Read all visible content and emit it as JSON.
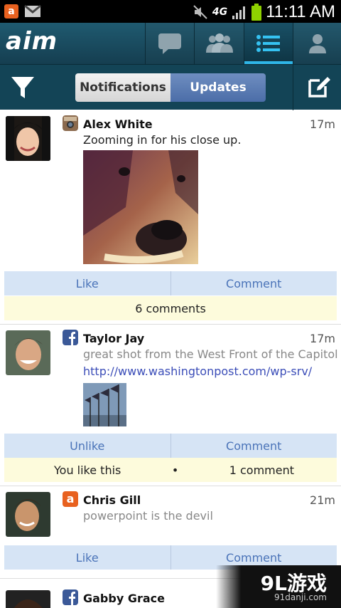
{
  "status_bar": {
    "time": "11:11 AM",
    "network": "4G",
    "icons": [
      "app-notification-icon",
      "gmail-icon",
      "mute-icon",
      "signal-icon",
      "battery-icon"
    ]
  },
  "app": {
    "logo": "aim",
    "tabs": [
      "chat-icon",
      "buddies-icon",
      "list-icon",
      "profile-icon"
    ],
    "active_tab": "list-icon",
    "accent": "#2fb6e8"
  },
  "toolbar": {
    "notifications_label": "Notifications",
    "updates_label": "Updates",
    "icons": [
      "filter-icon",
      "compose-icon"
    ]
  },
  "posts": [
    {
      "name": "Alex White",
      "time": "17m",
      "source": "instagram-icon",
      "text": "Zooming in for his close up.",
      "actions": [
        "Like",
        "Comment"
      ],
      "meta": "6 comments"
    },
    {
      "name": "Taylor Jay",
      "time": "17m",
      "source": "facebook-icon",
      "text": "great shot from the West Front of the Capitol",
      "link": "http://www.washingtonpost.com/wp-srv/",
      "actions": [
        "Unlike",
        "Comment"
      ],
      "meta_left": "You like this",
      "meta_sep": "•",
      "meta_right": "1 comment"
    },
    {
      "name": "Chris Gill",
      "time": "21m",
      "source": "aim-icon",
      "text": "powerpoint is the devil",
      "actions": [
        "Like",
        "Comment"
      ]
    },
    {
      "name": "Gabby Grace",
      "source": "facebook-icon"
    }
  ],
  "watermark": {
    "main": "9L游戏",
    "sub": "91danji.com"
  }
}
